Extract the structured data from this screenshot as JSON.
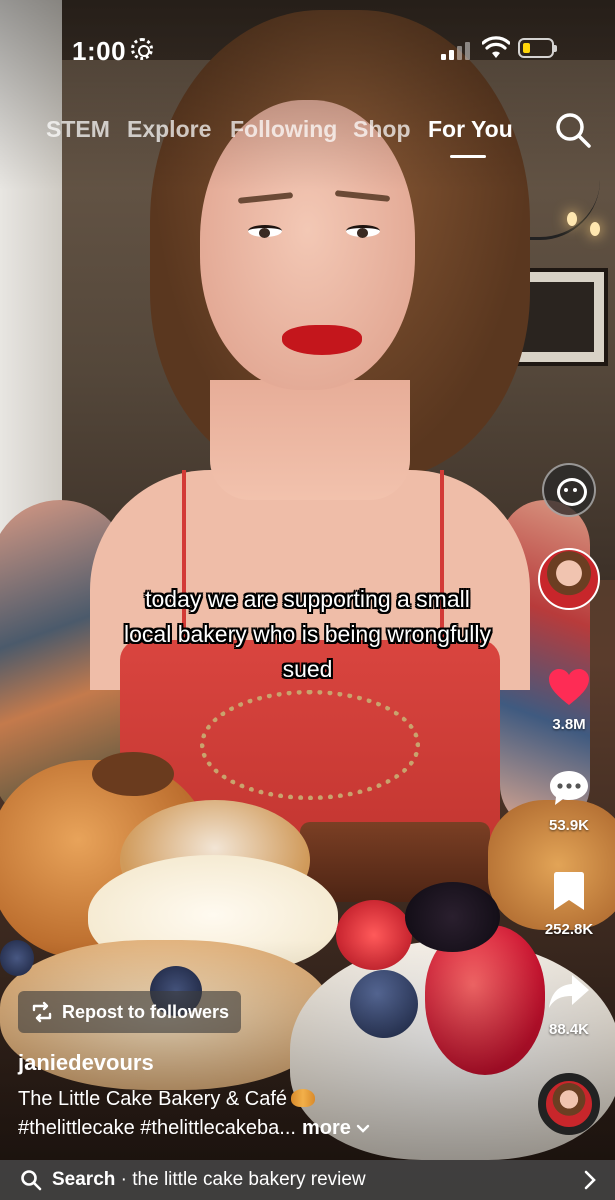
{
  "status_bar": {
    "time": "1:00"
  },
  "top_nav": {
    "tabs": [
      {
        "label": "STEM"
      },
      {
        "label": "Explore"
      },
      {
        "label": "Following"
      },
      {
        "label": "Shop"
      },
      {
        "label": "For You"
      }
    ],
    "active_tab": "For You"
  },
  "video": {
    "caption": "today we are supporting a small local bakery who is being wrongfully sued"
  },
  "actions": {
    "likes": "3.8M",
    "comments": "53.9K",
    "saves": "252.8K",
    "shares": "88.4K"
  },
  "post": {
    "repost_label": "Repost to followers",
    "username": "janiedevours",
    "description": "The Little Cake Bakery & Café",
    "hashtags": "#thelittlecake #thelittlecakeba...",
    "more_label": "more"
  },
  "search_bar": {
    "label": "Search",
    "query": "the little cake bakery review"
  },
  "colors": {
    "heart": "#fe2c55",
    "caption_outline": "#000000",
    "battery": "#ffd60a"
  }
}
